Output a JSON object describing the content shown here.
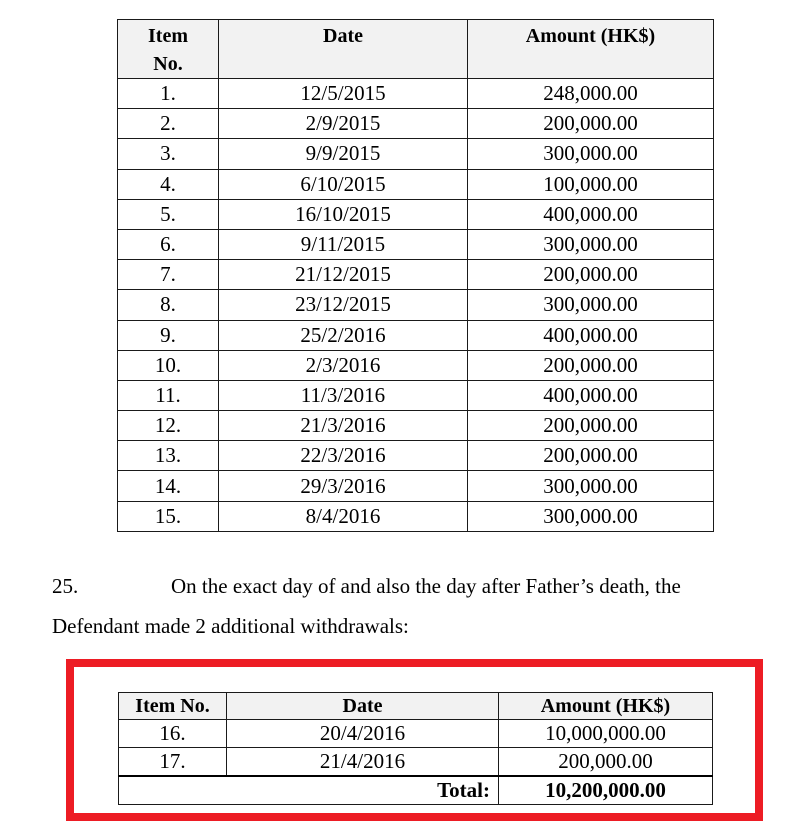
{
  "table1": {
    "headers": {
      "item": "Item No.",
      "item_line1": "Item",
      "item_line2": "No.",
      "date": "Date",
      "amount": "Amount (HK$)"
    },
    "rows": [
      {
        "item": "1.",
        "date": "12/5/2015",
        "amount": "248,000.00"
      },
      {
        "item": "2.",
        "date": "2/9/2015",
        "amount": "200,000.00"
      },
      {
        "item": "3.",
        "date": "9/9/2015",
        "amount": "300,000.00"
      },
      {
        "item": "4.",
        "date": "6/10/2015",
        "amount": "100,000.00"
      },
      {
        "item": "5.",
        "date": "16/10/2015",
        "amount": "400,000.00"
      },
      {
        "item": "6.",
        "date": "9/11/2015",
        "amount": "300,000.00"
      },
      {
        "item": "7.",
        "date": "21/12/2015",
        "amount": "200,000.00"
      },
      {
        "item": "8.",
        "date": "23/12/2015",
        "amount": "300,000.00"
      },
      {
        "item": "9.",
        "date": "25/2/2016",
        "amount": "400,000.00"
      },
      {
        "item": "10.",
        "date": "2/3/2016",
        "amount": "200,000.00"
      },
      {
        "item": "11.",
        "date": "11/3/2016",
        "amount": "400,000.00"
      },
      {
        "item": "12.",
        "date": "21/3/2016",
        "amount": "200,000.00"
      },
      {
        "item": "13.",
        "date": "22/3/2016",
        "amount": "200,000.00"
      },
      {
        "item": "14.",
        "date": "29/3/2016",
        "amount": "300,000.00"
      },
      {
        "item": "15.",
        "date": "8/4/2016",
        "amount": "300,000.00"
      }
    ]
  },
  "paragraph": {
    "number": "25.",
    "line1": "On the exact day of and also the day after Father’s death, the",
    "line2": "Defendant made 2 additional withdrawals:"
  },
  "highlight": {
    "border_color": "#ed1c24"
  },
  "table2": {
    "headers": {
      "item": "Item No.",
      "date": "Date",
      "amount": "Amount (HK$)"
    },
    "rows": [
      {
        "item": "16.",
        "date": "20/4/2016",
        "amount": "10,000,000.00"
      },
      {
        "item": "17.",
        "date": "21/4/2016",
        "amount": "200,000.00"
      }
    ],
    "total_label": "Total:",
    "total_value": "10,200,000.00"
  }
}
